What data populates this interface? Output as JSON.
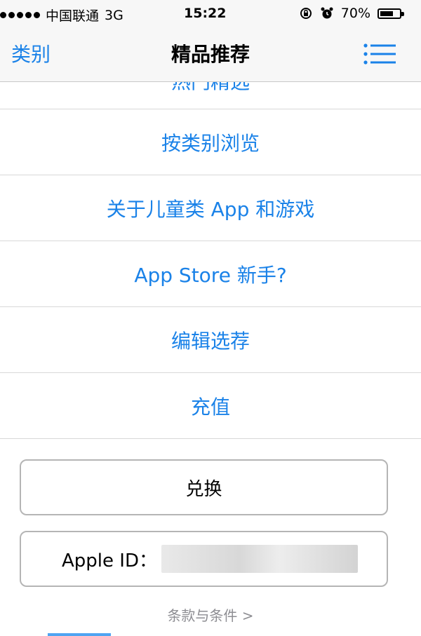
{
  "status_bar": {
    "carrier": "中国联通",
    "network": "3G",
    "time": "15:22",
    "battery": "70%",
    "battery_level": 0.7,
    "icons": [
      "signal-dots",
      "rotation-lock-icon",
      "alarm-icon",
      "battery-icon"
    ]
  },
  "nav": {
    "back_label": "类别",
    "title": "精品推荐",
    "list_icon": "list-icon"
  },
  "menu": {
    "partial_item": "热门精选",
    "items": [
      {
        "label": "按类别浏览"
      },
      {
        "label": "关于儿童类 App 和游戏"
      },
      {
        "label": "App Store 新手?"
      },
      {
        "label": "编辑选荐"
      },
      {
        "label": "充值"
      }
    ]
  },
  "buttons": {
    "redeem_label": "兑换",
    "apple_id_label": "Apple ID："
  },
  "terms_label": "条款与条件 >",
  "colors": {
    "accent": "#1a82e8",
    "border": "#b5b5b5",
    "muted": "#8e8e93"
  }
}
